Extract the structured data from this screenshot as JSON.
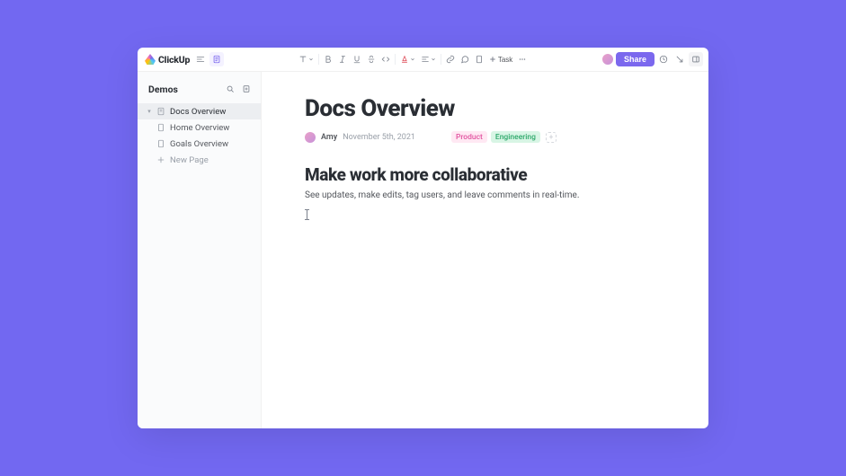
{
  "brand": {
    "name": "ClickUp"
  },
  "topbar": {
    "share_label": "Share",
    "task_label": "Task"
  },
  "sidebar": {
    "title": "Demos",
    "items": [
      {
        "label": "Docs Overview",
        "active": true,
        "caret": true
      },
      {
        "label": "Home Overview",
        "active": false,
        "caret": false
      },
      {
        "label": "Goals Overview",
        "active": false,
        "caret": false
      }
    ],
    "new_page_label": "New Page"
  },
  "doc": {
    "title": "Docs Overview",
    "author": "Amy",
    "date": "November 5th, 2021",
    "tags": {
      "product": "Product",
      "engineering": "Engineering"
    },
    "h2": "Make work more collaborative",
    "p1": "See updates, make edits, tag users, and leave comments in real-time."
  }
}
